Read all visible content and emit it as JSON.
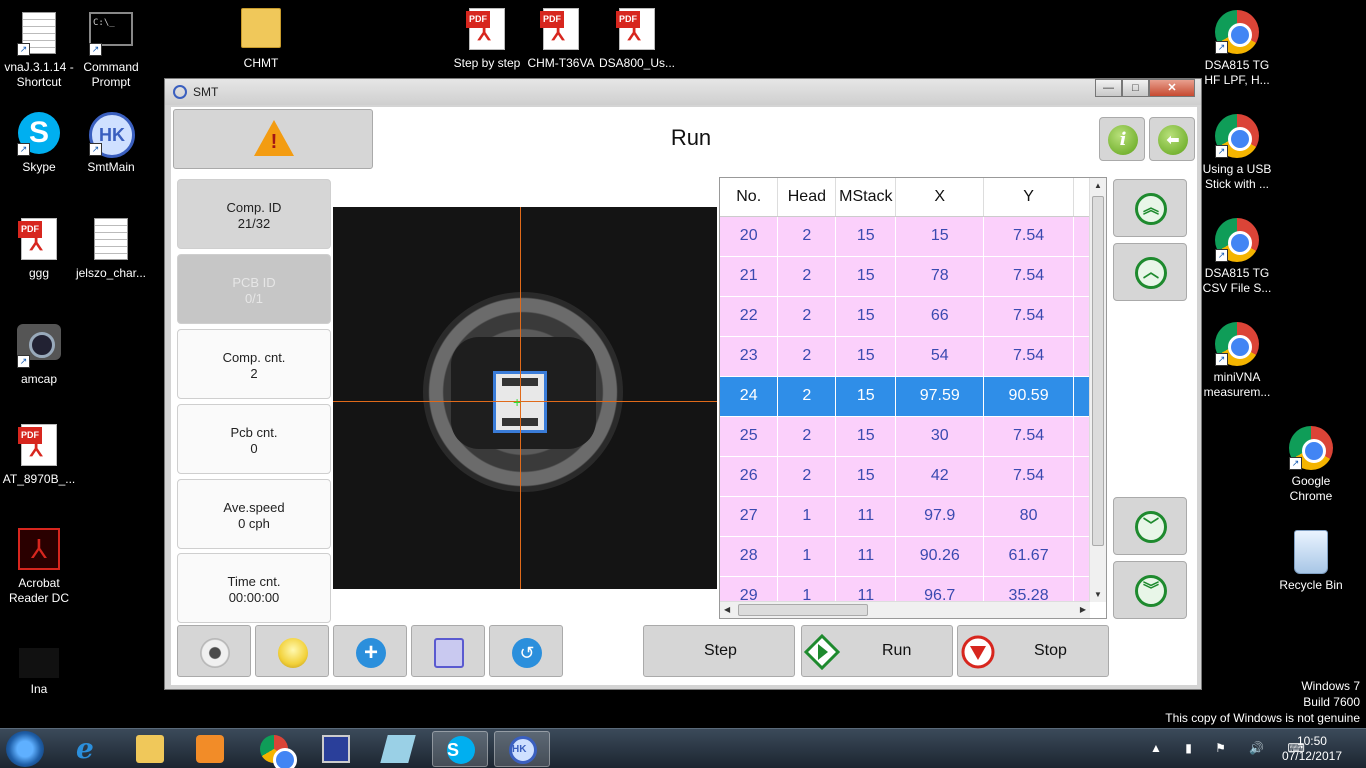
{
  "desktop": {
    "left_icons": [
      {
        "label": "vnaJ.3.1.14 -\nShortcut"
      },
      {
        "label": "Command\nPrompt"
      },
      {
        "label": "CHMT"
      },
      {
        "label": "Step by step"
      },
      {
        "label": "CHM-T36VA"
      },
      {
        "label": "DSA800_Us..."
      },
      {
        "label": "Skype"
      },
      {
        "label": "SmtMain"
      },
      {
        "label": "ggg"
      },
      {
        "label": "jelszo_char..."
      },
      {
        "label": "amcap"
      },
      {
        "label": "AT_8970B_..."
      },
      {
        "label": "Acrobat\nReader DC"
      },
      {
        "label": "Ina"
      }
    ],
    "right_icons": [
      {
        "label": "DSA815 TG\nHF LPF, H..."
      },
      {
        "label": "Using a USB\nStick with ..."
      },
      {
        "label": "DSA815 TG\nCSV File S..."
      },
      {
        "label": "miniVNA\nmeasurem..."
      },
      {
        "label": "Google\nChrome"
      },
      {
        "label": "Recycle Bin"
      }
    ],
    "watermark": {
      "line1": "Windows 7",
      "line2": "Build 7600",
      "line3": "This copy of Windows is not genuine"
    }
  },
  "window": {
    "title": "SMT",
    "controls": {
      "minimize": "—",
      "maximize": "□",
      "close": "✕"
    },
    "header": {
      "title": "Run",
      "info_glyph": "i",
      "back_glyph": "⬅"
    },
    "info_panel": [
      {
        "label": "Comp. ID",
        "value": "21/32"
      },
      {
        "label": "PCB ID",
        "value": "0/1"
      },
      {
        "label": "Comp. cnt.",
        "value": "2"
      },
      {
        "label": "Pcb cnt.",
        "value": "0"
      },
      {
        "label": "Ave.speed",
        "value": "0 cph"
      },
      {
        "label": "Time cnt.",
        "value": "00:00:00"
      }
    ],
    "table": {
      "columns": [
        "No.",
        "Head",
        "MStack",
        "X",
        "Y"
      ],
      "rows": [
        [
          "20",
          "2",
          "15",
          "15",
          "7.54"
        ],
        [
          "21",
          "2",
          "15",
          "78",
          "7.54"
        ],
        [
          "22",
          "2",
          "15",
          "66",
          "7.54"
        ],
        [
          "23",
          "2",
          "15",
          "54",
          "7.54"
        ],
        [
          "24",
          "2",
          "15",
          "97.59",
          "90.59"
        ],
        [
          "25",
          "2",
          "15",
          "30",
          "7.54"
        ],
        [
          "26",
          "2",
          "15",
          "42",
          "7.54"
        ],
        [
          "27",
          "1",
          "11",
          "97.9",
          "80"
        ],
        [
          "28",
          "1",
          "11",
          "90.26",
          "61.67"
        ],
        [
          "29",
          "1",
          "11",
          "96.7",
          "35.28"
        ]
      ],
      "selected_row": "24"
    },
    "actions": {
      "step": "Step",
      "run": "Run",
      "stop": "Stop"
    }
  },
  "taskbar": {
    "time": "10:50",
    "date": "07/12/2017"
  },
  "colors": {
    "row_bg": "#fbd0fb",
    "selected_bg": "#2f8ee8",
    "accent_green": "#1e8a2e",
    "crosshair": "#e06a1a"
  }
}
